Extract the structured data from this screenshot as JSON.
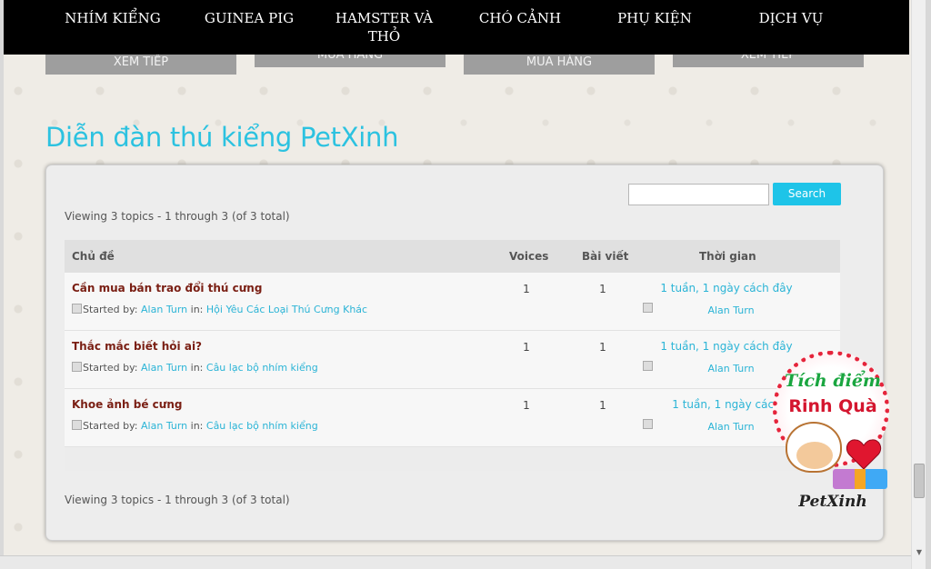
{
  "nav": {
    "items": [
      "NHÍM KIỂNG",
      "GUINEA PIG",
      "HAMSTER VÀ THỎ",
      "CHÓ CẢNH",
      "PHỤ KIỆN",
      "DỊCH VỤ"
    ]
  },
  "product_buttons": [
    "XEM TIẾP",
    "MUA HÀNG",
    "MUA HÀNG",
    "XEM TIẾP"
  ],
  "forum": {
    "title": "Diễn đàn thú kiểng PetXinh",
    "search_button": "Search",
    "search_value": "",
    "viewing_text": "Viewing 3 topics - 1 through 3 (of 3 total)",
    "columns": {
      "topic": "Chủ đề",
      "voices": "Voices",
      "posts": "Bài viết",
      "time": "Thời gian"
    },
    "started_by_label": "Started by:",
    "in_label": "in:",
    "topics": [
      {
        "title": "Cần mua bán trao đổi thú cưng",
        "author": "Alan Turn",
        "forum": "Hội Yêu Các Loại Thú Cưng Khác",
        "voices": "1",
        "posts": "1",
        "freshness": "1 tuần, 1 ngày cách đây",
        "last_user": "Alan Turn"
      },
      {
        "title": "Thắc mắc biết hỏi ai?",
        "author": "Alan Turn",
        "forum": "Câu lạc bộ nhím kiểng",
        "voices": "1",
        "posts": "1",
        "freshness": "1 tuần, 1 ngày cách đây",
        "last_user": "Alan Turn"
      },
      {
        "title": "Khoe ảnh bé cưng",
        "author": "Alan Turn",
        "forum": "Câu lạc bộ nhím kiểng",
        "voices": "1",
        "posts": "1",
        "freshness": "1 tuần, 1 ngày cách",
        "last_user": "Alan Turn"
      }
    ]
  },
  "promo": {
    "line1": "Tích điểm",
    "line2": "Rinh Quà",
    "brand": "PetXinh"
  },
  "colors": {
    "accent": "#2cc2e0",
    "nav_bg": "#000000",
    "topic_title": "#7a1f14",
    "link": "#2bb4d6",
    "search_button": "#1ec4e8"
  }
}
